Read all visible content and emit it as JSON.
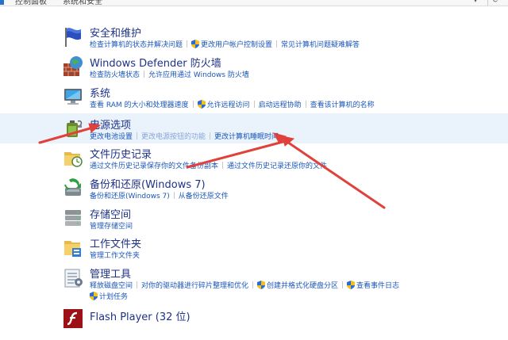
{
  "breadcrumb": {
    "part1": "控制面板",
    "part2": "系统和安全"
  },
  "sections": [
    {
      "title": "安全和维护",
      "links": [
        "检查计算机的状态并解决问题",
        "更改用户帐户控制设置",
        "常见计算机问题疑难解答"
      ]
    },
    {
      "title": "Windows Defender 防火墙",
      "links": [
        "检查防火墙状态",
        "允许应用通过 Windows 防火墙"
      ]
    },
    {
      "title": "系统",
      "links": [
        "查看 RAM 的大小和处理器速度",
        "允许远程访问",
        "启动远程协助",
        "查看该计算机的名称"
      ]
    },
    {
      "title": "电源选项",
      "links": [
        "更改电池设置",
        "更改电源按钮的功能",
        "更改计算机睡眠时间"
      ]
    },
    {
      "title": "文件历史记录",
      "links": [
        "通过文件历史记录保存你的文件备份副本",
        "通过文件历史记录还原你的文件"
      ]
    },
    {
      "title": "备份和还原(Windows 7)",
      "links": [
        "备份和还原(Windows 7)",
        "从备份还原文件"
      ]
    },
    {
      "title": "存储空间",
      "links": [
        "管理存储空间"
      ]
    },
    {
      "title": "工作文件夹",
      "links": [
        "管理工作文件夹"
      ]
    },
    {
      "title": "管理工具",
      "links": [
        "释放磁盘空间",
        "对你的驱动器进行碎片整理和优化",
        "创建并格式化硬盘分区",
        "查看事件日志",
        "计划任务"
      ]
    },
    {
      "title": "Flash Player (32 位)",
      "links": []
    }
  ],
  "colors": {
    "title": "#1e3287",
    "link": "#1a56b8",
    "highlight": "#eaf3fc",
    "arrow": "#e0413a"
  }
}
